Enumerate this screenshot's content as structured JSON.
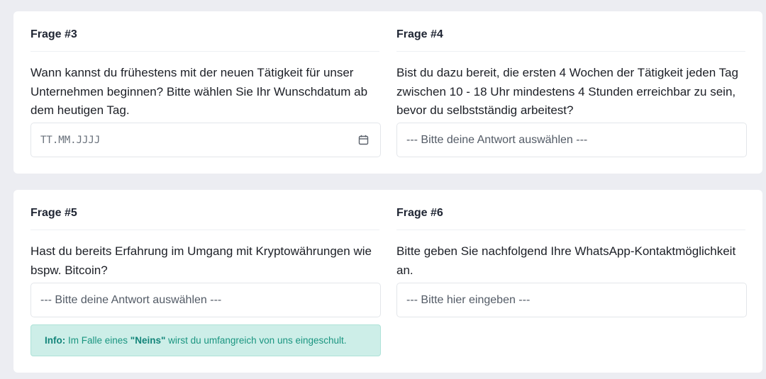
{
  "questions": [
    {
      "title": "Frage #3",
      "text": "Wann kannst du frühestens mit der neuen Tätigkeit für unser Unternehmen beginnen? Bitte wählen Sie Ihr Wunschdatum ab dem heutigen Tag.",
      "field_type": "date",
      "placeholder": "TT.MM.JJJJ",
      "icon": "calendar-icon"
    },
    {
      "title": "Frage #4",
      "text": "Bist du dazu bereit, die ersten 4 Wochen der Tätigkeit jeden Tag zwischen 10 - 18 Uhr mindestens 4 Stunden erreichbar zu sein, bevor du selbstständig arbeitest?",
      "field_type": "select",
      "placeholder": "--- Bitte deine Antwort auswählen ---"
    },
    {
      "title": "Frage #5",
      "text": "Hast du bereits Erfahrung im Umgang mit Kryptowährungen wie bspw. Bitcoin?",
      "field_type": "select",
      "placeholder": "--- Bitte deine Antwort auswählen ---",
      "info": {
        "label": "Info:",
        "before": " Im Falle eines ",
        "emph": "\"Neins\"",
        "after": " wirst du umfangreich von uns eingeschult."
      }
    },
    {
      "title": "Frage #6",
      "text": "Bitte geben Sie nachfolgend Ihre WhatsApp-Kontaktmöglichkeit an.",
      "field_type": "text",
      "placeholder": "--- Bitte hier eingeben ---"
    }
  ],
  "colors": {
    "page_background": "#ecedf2",
    "card_background": "#ffffff",
    "info_background": "#cdeee8",
    "info_text": "#1a9580"
  }
}
